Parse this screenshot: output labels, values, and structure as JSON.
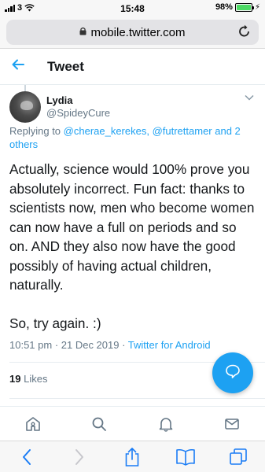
{
  "status_bar": {
    "carrier": "3",
    "time": "15:48",
    "battery": "98%",
    "battery_level": 0.98
  },
  "browser": {
    "url": "mobile.twitter.com"
  },
  "header": {
    "title": "Tweet"
  },
  "tweet": {
    "author_name": "Lydia",
    "author_handle": "@SpideyCure",
    "reply_prefix": "Replying to ",
    "reply_mentions": "@cherae_kerekes, @futrettamer",
    "reply_suffix": " and 2 others",
    "text": "Actually, science would 100% prove you absolutely incorrect. Fun fact: thanks to scientists now, men who become women can now have a full on periods and so on. AND they also now have the good possibly of having actual children, naturally.\n\nSo, try again. :)",
    "timestamp": "10:51 pm · 21 Dec 2019 · ",
    "source": "Twitter for Android",
    "likes_count": "19",
    "likes_label": "Likes"
  },
  "icons": {
    "back": "arrow-left-icon",
    "compose": "reply-bubble-icon",
    "nav": [
      "home-icon",
      "search-icon",
      "notifications-icon",
      "messages-icon"
    ],
    "safari": [
      "back-icon",
      "forward-icon",
      "share-icon",
      "bookmarks-icon",
      "tabs-icon"
    ]
  },
  "colors": {
    "accent": "#1da1f2",
    "text": "#14171a",
    "secondary": "#657786"
  }
}
